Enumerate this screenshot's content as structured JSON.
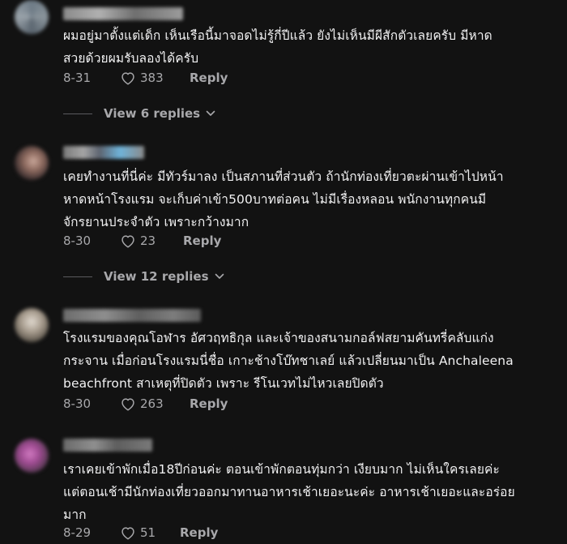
{
  "comments": [
    {
      "text_lines": [
        "ผมอยู่มาตั้งแต่เด็ก เห็นเรือนี้มาจอดไม่รู้กี่ปีแล้ว ยังไม่เห็นมีผีสักตัวเลยครับ มีหาด",
        "สวยด้วยผมรับลองได้ครับ"
      ],
      "date": "8-31",
      "likes": "383",
      "reply_label": "Reply",
      "view_replies": "View 6 replies"
    },
    {
      "text_lines": [
        "เคยทำงานที่นี่ค่ะ มีทัวร์มาลง เป็นสภานที่ส่วนตัว ถ้านักท่องเที่ยวตะผ่านเข้าไปหน้า",
        "หาดหน้าโรงแรม จะเก็บค่าเข้า500บาทต่อคน ไม่มีเรื่องหลอน พนักงานทุกคนมี",
        "จักรยานประจำตัว เพราะกว้างมาก"
      ],
      "date": "8-30",
      "likes": "23",
      "reply_label": "Reply",
      "view_replies": "View 12 replies"
    },
    {
      "text_lines": [
        "โรงแรมของคุณโอฬาร อัศวฤทธิกุล และเจ้าของสนามกอล์ฟสยามคันทรี่คลับแก่ง",
        "กระจาน เมื่อก่อนโรงแรมนี่ชื่อ เกาะช้างโบ๊ทชาเลย์ แล้วเปลี่ยนมาเป็น Anchaleena",
        "beachfront สาเหตุที่ปิดตัว เพราะ รีโนเวทไม่ไหวเลยปิดตัว"
      ],
      "date": "8-30",
      "likes": "263",
      "reply_label": "Reply"
    },
    {
      "text_lines": [
        "เราเคยเข้าพักเมื่อ18ปีก่อนค่ะ ตอนเข้าพักตอนทุ่มกว่า เงียบมาก ไม่เห็นใครเลยค่ะ",
        "แต่ตอนเช้ามีนักท่องเที่ยวออกมาทานอาหารเช้าเยอะนะค่ะ อาหารเช้าเยอะและอร่อย",
        "มาก"
      ],
      "date": "8-29",
      "likes": "51",
      "reply_label": "Reply"
    }
  ],
  "colors": {
    "background": "#121212",
    "text": "#f1f1f2",
    "muted": "#a8a8ab"
  },
  "icons": {
    "like": "heart-outline-icon",
    "expand": "chevron-down-icon"
  }
}
